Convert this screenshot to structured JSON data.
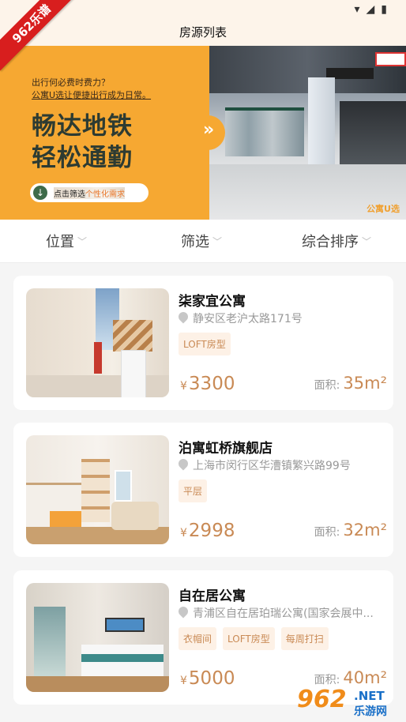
{
  "app": {
    "title": "房源列表"
  },
  "ribbon": {
    "text": "962乐谱"
  },
  "banner": {
    "sub_line1": "出行何必费时费力？",
    "sub_line2": "公寓U选让便捷出行成为日常。",
    "headline1": "畅达地铁",
    "headline2": "轻松通勤",
    "pill_text_a": "点击筛选",
    "pill_text_b": "个性化需求",
    "logo_text": "公寓U选"
  },
  "filters": [
    {
      "label": "位置"
    },
    {
      "label": "筛选"
    },
    {
      "label": "综合排序"
    }
  ],
  "listings": [
    {
      "name": "柒家宜公寓",
      "address": "静安区老沪太路171号",
      "tags": [
        "LOFT房型"
      ],
      "price_symbol": "¥",
      "price": "3300",
      "area_label": "面积:",
      "area": "35m²"
    },
    {
      "name": "泊寓虹桥旗舰店",
      "address": "上海市闵行区华漕镇繁兴路99号",
      "tags": [
        "平层"
      ],
      "price_symbol": "¥",
      "price": "2998",
      "area_label": "面积:",
      "area": "32m²"
    },
    {
      "name": "自在居公寓",
      "address": "青浦区自在居珀瑞公寓(国家会展中...",
      "tags": [
        "衣帽间",
        "LOFT房型",
        "每周打扫"
      ],
      "price_symbol": "¥",
      "price": "5000",
      "area_label": "面积:",
      "area": "40m²"
    }
  ],
  "watermark": {
    "big": "962",
    "line1": ".NET",
    "line2": "乐游网"
  },
  "colors": {
    "accent": "#c98a55",
    "banner": "#f6a832",
    "header_bg": "#fdf4ea"
  }
}
